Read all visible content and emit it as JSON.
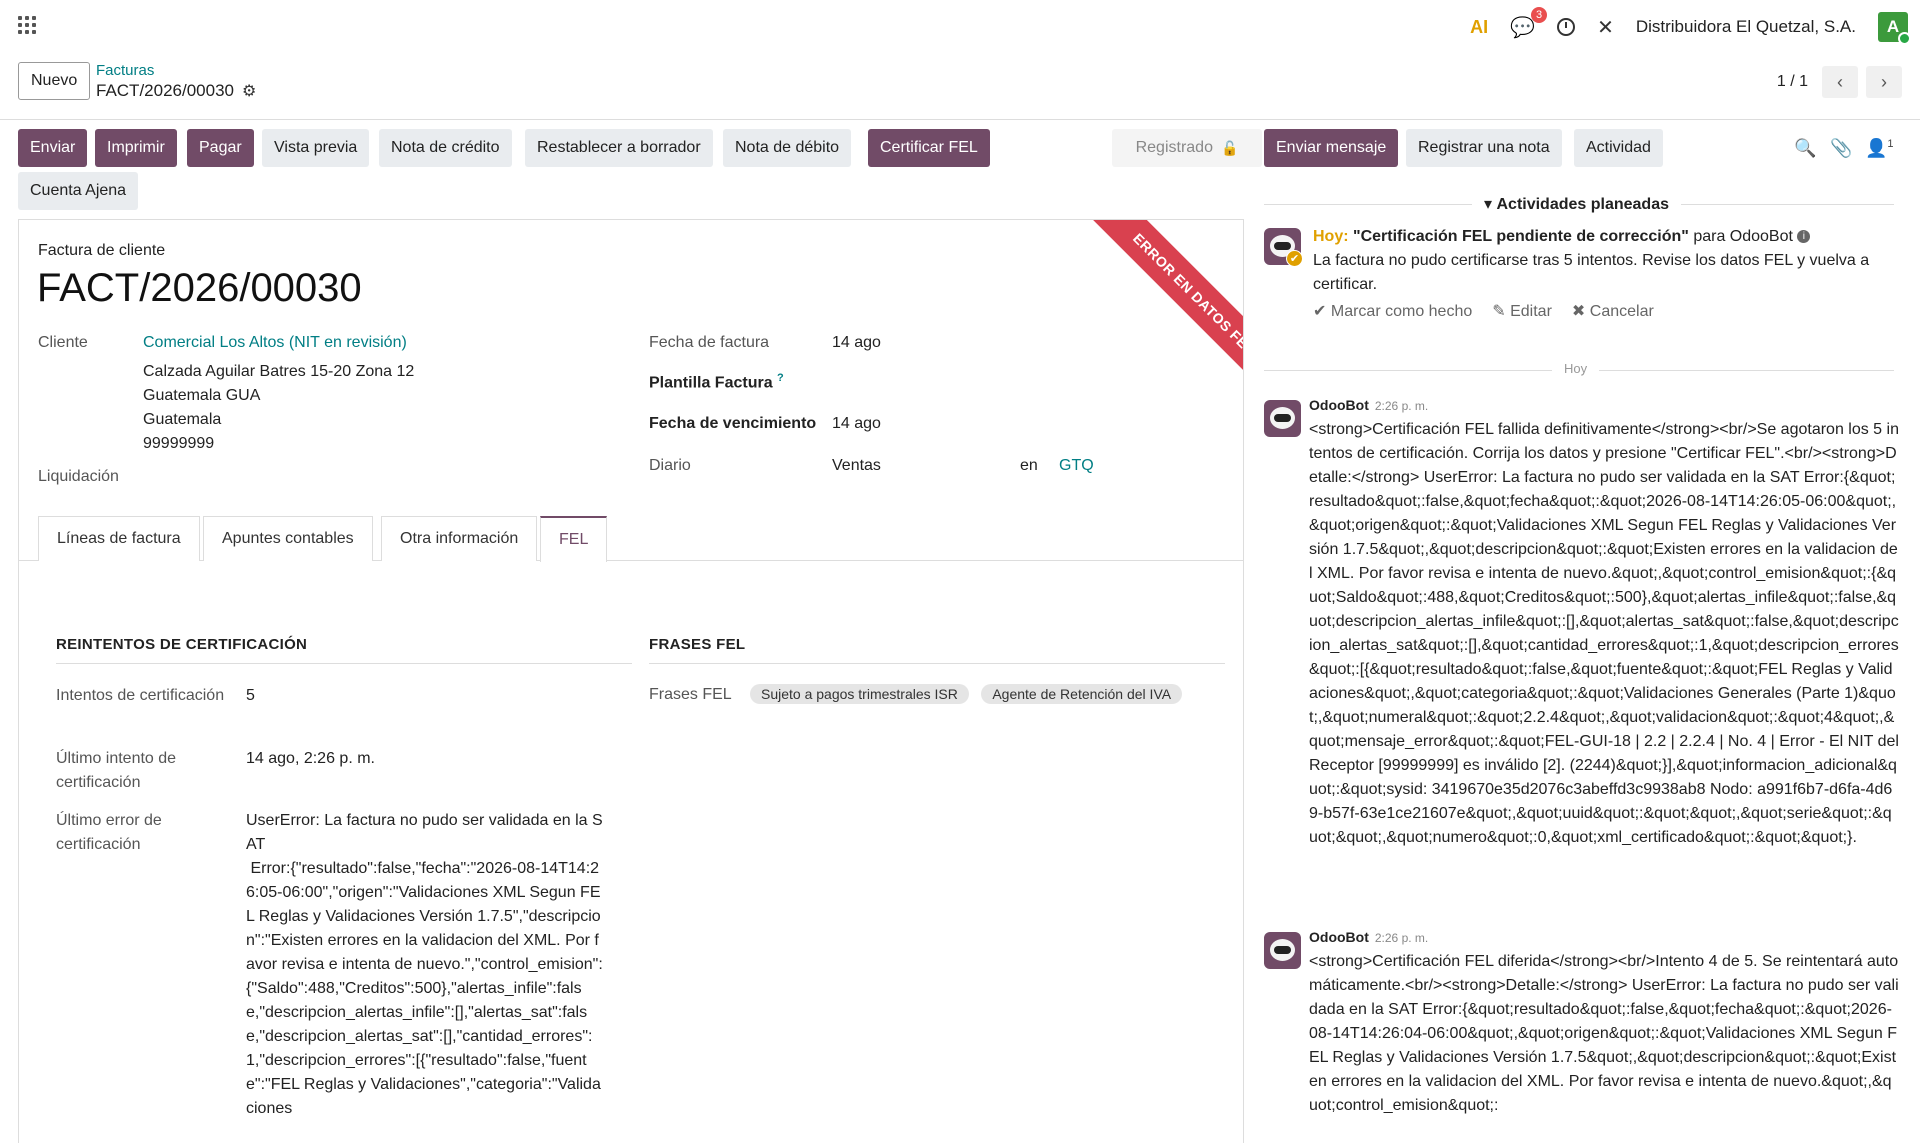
{
  "topbar": {
    "ai_label": "AI",
    "chat_badge": "3",
    "company": "Distribuidora El Quetzal, S.A.",
    "avatar_letter": "A"
  },
  "control_panel": {
    "new_label": "Nuevo",
    "breadcrumb_parent": "Facturas",
    "breadcrumb_current": "FACT/2026/00030",
    "pager": "1 / 1"
  },
  "actions": {
    "enviar": "Enviar",
    "imprimir": "Imprimir",
    "pagar": "Pagar",
    "vista_previa": "Vista previa",
    "nota_credito": "Nota de crédito",
    "restablecer": "Restablecer a borrador",
    "nota_debito": "Nota de débito",
    "certificar": "Certificar FEL",
    "cuenta_ajena": "Cuenta Ajena",
    "status": "Registrado"
  },
  "sheet": {
    "ribbon": "ERROR EN DATOS FEL",
    "doc_type": "Factura de cliente",
    "doc_name": "FACT/2026/00030",
    "cliente_label": "Cliente",
    "cliente_name": "Comercial Los Altos (NIT en revisión)",
    "address": [
      "Calzada Aguilar Batres 15-20 Zona 12",
      "Guatemala GUA",
      "Guatemala",
      "99999999"
    ],
    "liquidacion_label": "Liquidación",
    "fecha_factura_label": "Fecha de factura",
    "fecha_factura": "14 ago",
    "plantilla_label": "Plantilla Factura",
    "plantilla_help": "?",
    "vencimiento_label": "Fecha de vencimiento",
    "vencimiento": "14 ago",
    "diario_label": "Diario",
    "diario": "Ventas",
    "en_label": "en",
    "currency": "GTQ"
  },
  "tabs": [
    "Líneas de factura",
    "Apuntes contables",
    "Otra información",
    "FEL"
  ],
  "fel": {
    "reintentos_title": "REINTENTOS DE CERTIFICACIÓN",
    "frases_title": "FRASES FEL",
    "intentos_label": "Intentos de certificación",
    "intentos": "5",
    "ultimo_intento_label": "Último intento de certificación",
    "ultimo_intento": "14 ago, 2:26 p. m.",
    "ultimo_error_label": "Último error de certificación",
    "ultimo_error": "UserError: La factura no pudo ser validada en la SAT\n Error:{\"resultado\":false,\"fecha\":\"2026-08-14T14:26:05-06:00\",\"origen\":\"Validaciones XML Segun FEL Reglas y Validaciones Versión 1.7.5\",\"descripcion\":\"Existen errores en la validacion del XML. Por favor revisa e intenta de nuevo.\",\"control_emision\":{\"Saldo\":488,\"Creditos\":500},\"alertas_infile\":false,\"descripcion_alertas_infile\":[],\"alertas_sat\":false,\"descripcion_alertas_sat\":[],\"cantidad_errores\":1,\"descripcion_errores\":[{\"resultado\":false,\"fuente\":\"FEL Reglas y Validaciones\",\"categoria\":\"Validaciones",
    "frases_label": "Frases FEL",
    "frases": [
      "Sujeto a pagos trimestrales ISR",
      "Agente de Retención del IVA"
    ]
  },
  "chatter": {
    "send_message": "Enviar mensaje",
    "log_note": "Registrar una nota",
    "activity": "Actividad",
    "followers_count": "1",
    "planned_title": "Actividades planeadas",
    "activity_today": "Hoy:",
    "activity_summary": "\"Certificación FEL pendiente de corrección\"",
    "activity_for": "para OdooBot",
    "activity_note": "La factura no pudo certificarse tras 5 intentos. Revise los datos FEL y vuelva a certificar.",
    "mark_done": "Marcar como hecho",
    "edit": "Editar",
    "cancel": "Cancelar",
    "today_divider": "Hoy",
    "messages": [
      {
        "author": "OdooBot",
        "time": "2:26 p. m.",
        "body": "<strong>Certificación FEL fallida definitivamente</strong><br/>Se agotaron los 5 intentos de certificación. Corrija los datos y presione \"Certificar FEL\".<br/><strong>Detalle:</strong> UserError: La factura no pudo ser validada en la SAT Error:{&quot;resultado&quot;:false,&quot;fecha&quot;:&quot;2026-08-14T14:26:05-06:00&quot;,&quot;origen&quot;:&quot;Validaciones XML Segun FEL Reglas y Validaciones Versión 1.7.5&quot;,&quot;descripcion&quot;:&quot;Existen errores en la validacion del XML. Por favor revisa e intenta de nuevo.&quot;,&quot;control_emision&quot;:{&quot;Saldo&quot;:488,&quot;Creditos&quot;:500},&quot;alertas_infile&quot;:false,&quot;descripcion_alertas_infile&quot;:[],&quot;alertas_sat&quot;:false,&quot;descripcion_alertas_sat&quot;:[],&quot;cantidad_errores&quot;:1,&quot;descripcion_errores&quot;:[{&quot;resultado&quot;:false,&quot;fuente&quot;:&quot;FEL Reglas y Validaciones&quot;,&quot;categoria&quot;:&quot;Validaciones Generales (Parte 1)&quot;,&quot;numeral&quot;:&quot;2.2.4&quot;,&quot;validacion&quot;:&quot;4&quot;,&quot;mensaje_error&quot;:&quot;FEL-GUI-18 | 2.2 | 2.2.4 | No. 4 | Error - El NIT del Receptor [99999999] es inválido [2]. (2244)&quot;}],&quot;informacion_adicional&quot;:&quot;sysid: 3419670e35d2076c3abeffd3c9938ab8 Nodo: a991f6b7-d6fa-4d69-b57f-63e1ce21607e&quot;,&quot;uuid&quot;:&quot;&quot;,&quot;serie&quot;:&quot;&quot;,&quot;numero&quot;:0,&quot;xml_certificado&quot;:&quot;&quot;}."
      },
      {
        "author": "OdooBot",
        "time": "2:26 p. m.",
        "body": "<strong>Certificación FEL diferida</strong><br/>Intento 4 de 5. Se reintentará automáticamente.<br/><strong>Detalle:</strong> UserError: La factura no pudo ser validada en la SAT Error:{&quot;resultado&quot;:false,&quot;fecha&quot;:&quot;2026-08-14T14:26:04-06:00&quot;,&quot;origen&quot;:&quot;Validaciones XML Segun FEL Reglas y Validaciones Versión 1.7.5&quot;,&quot;descripcion&quot;:&quot;Existen errores en la validacion del XML. Por favor revisa e intenta de nuevo.&quot;,&quot;control_emision&quot;:"
      }
    ]
  },
  "colors": {
    "primary": "#714b67",
    "link": "#017e84",
    "ribbon": "#d9414f",
    "today": "#e0a000"
  }
}
